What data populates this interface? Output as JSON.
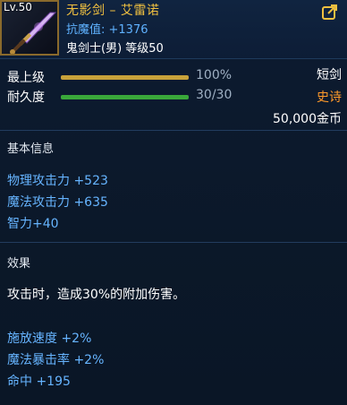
{
  "header": {
    "level": "Lv.50",
    "item_name": "无影剑 – 艾雷诺",
    "resist_label": "抗魔值: +1376",
    "requirement": "鬼剑士(男) 等级50"
  },
  "bars": {
    "grade": {
      "label": "最上级",
      "value": "100%",
      "fraction": 1.0,
      "color": "#c8a23a"
    },
    "durability": {
      "label": "耐久度",
      "value": "30/30",
      "fraction": 1.0,
      "color": "#3aa83a"
    }
  },
  "item_info": {
    "type": "短剑",
    "rarity": "史诗",
    "price": "50,000金币"
  },
  "basic_info": {
    "title": "基本信息",
    "stats": [
      "物理攻击力 +523",
      "魔法攻击力 +635",
      "智力+40"
    ]
  },
  "effects": {
    "title": "效果",
    "description": "攻击时，造成30%的附加伤害。",
    "stats": [
      "施放速度 +2%",
      "魔法暴击率 +2%",
      "命中 +195"
    ]
  },
  "colors": {
    "gold": "#f0c040",
    "blue_stat": "#66b4ff",
    "rarity": "#ff9a2a"
  },
  "icons": {
    "item": "sword-icon",
    "share": "share-icon"
  }
}
